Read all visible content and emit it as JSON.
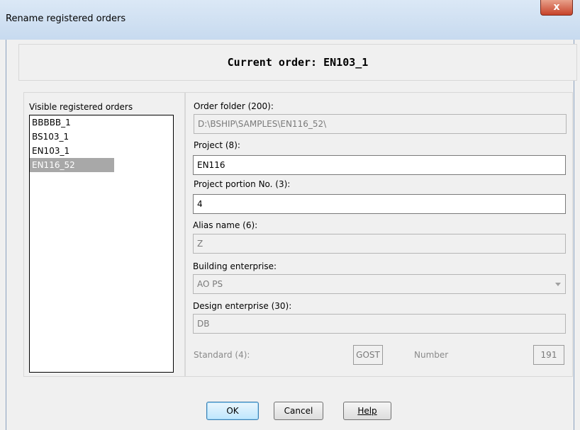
{
  "window": {
    "title": "Rename registered orders",
    "close_glyph": "x"
  },
  "header": {
    "text": "Current order: EN103_1"
  },
  "orders_list": {
    "label": "Visible registered orders",
    "items": [
      "BBBBB_1",
      "BS103_1",
      "EN103_1",
      "EN116_52"
    ],
    "selected": "EN116_52"
  },
  "form": {
    "order_folder": {
      "label": "Order folder (200):",
      "value": "D:\\BSHIP\\SAMPLES\\EN116_52\\"
    },
    "project": {
      "label": "Project (8):",
      "value": "EN116"
    },
    "project_portion": {
      "label": "Project portion No. (3):",
      "value": "4"
    },
    "alias_name": {
      "label": "Alias name (6):",
      "value": "Z"
    },
    "building_enterprise": {
      "label": "Building enterprise:",
      "value": "AO PS"
    },
    "design_enterprise": {
      "label": "Design enterprise (30):",
      "value": "DB"
    },
    "standard": {
      "label": "Standard (4):",
      "value": "GOST"
    },
    "number": {
      "label": "Number",
      "value": "191"
    }
  },
  "buttons": {
    "ok": "OK",
    "cancel": "Cancel",
    "help": "Help"
  }
}
